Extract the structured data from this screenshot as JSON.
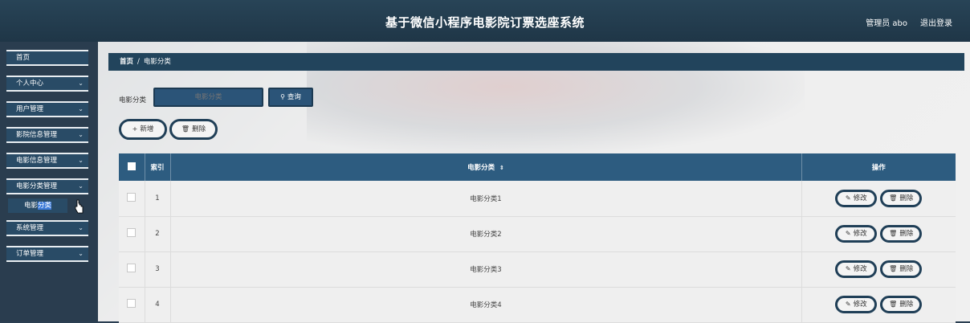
{
  "header": {
    "title": "基于微信小程序电影院订票选座系统",
    "user": "管理员 abo",
    "logout": "退出登录"
  },
  "sidebar": {
    "items": [
      {
        "label": "首页"
      },
      {
        "label": "个人中心"
      },
      {
        "label": "用户管理"
      },
      {
        "label": "影院信息管理"
      },
      {
        "label": "电影信息管理"
      },
      {
        "label": "电影分类管理"
      },
      {
        "label": "系统管理"
      },
      {
        "label": "订单管理"
      }
    ],
    "sub_item_part1": "电影",
    "sub_item_part2": "分类"
  },
  "breadcrumb": {
    "home": "首页",
    "separator": "/",
    "current": "电影分类"
  },
  "search": {
    "label": "电影分类",
    "placeholder": "电影分类",
    "button": "查询"
  },
  "actions": {
    "add": "新增",
    "delete": "删除"
  },
  "table": {
    "headers": {
      "index": "索引",
      "category": "电影分类",
      "sort_icon": "sort-icon",
      "ops": "操作"
    },
    "rows": [
      {
        "index": "1",
        "category": "电影分类1"
      },
      {
        "index": "2",
        "category": "电影分类2"
      },
      {
        "index": "3",
        "category": "电影分类3"
      },
      {
        "index": "4",
        "category": "电影分类4"
      }
    ],
    "edit_label": "修改",
    "delete_label": "删除"
  },
  "colors": {
    "header_bg": "#284457",
    "accent": "#2d5c80",
    "button_border": "#203f57"
  }
}
